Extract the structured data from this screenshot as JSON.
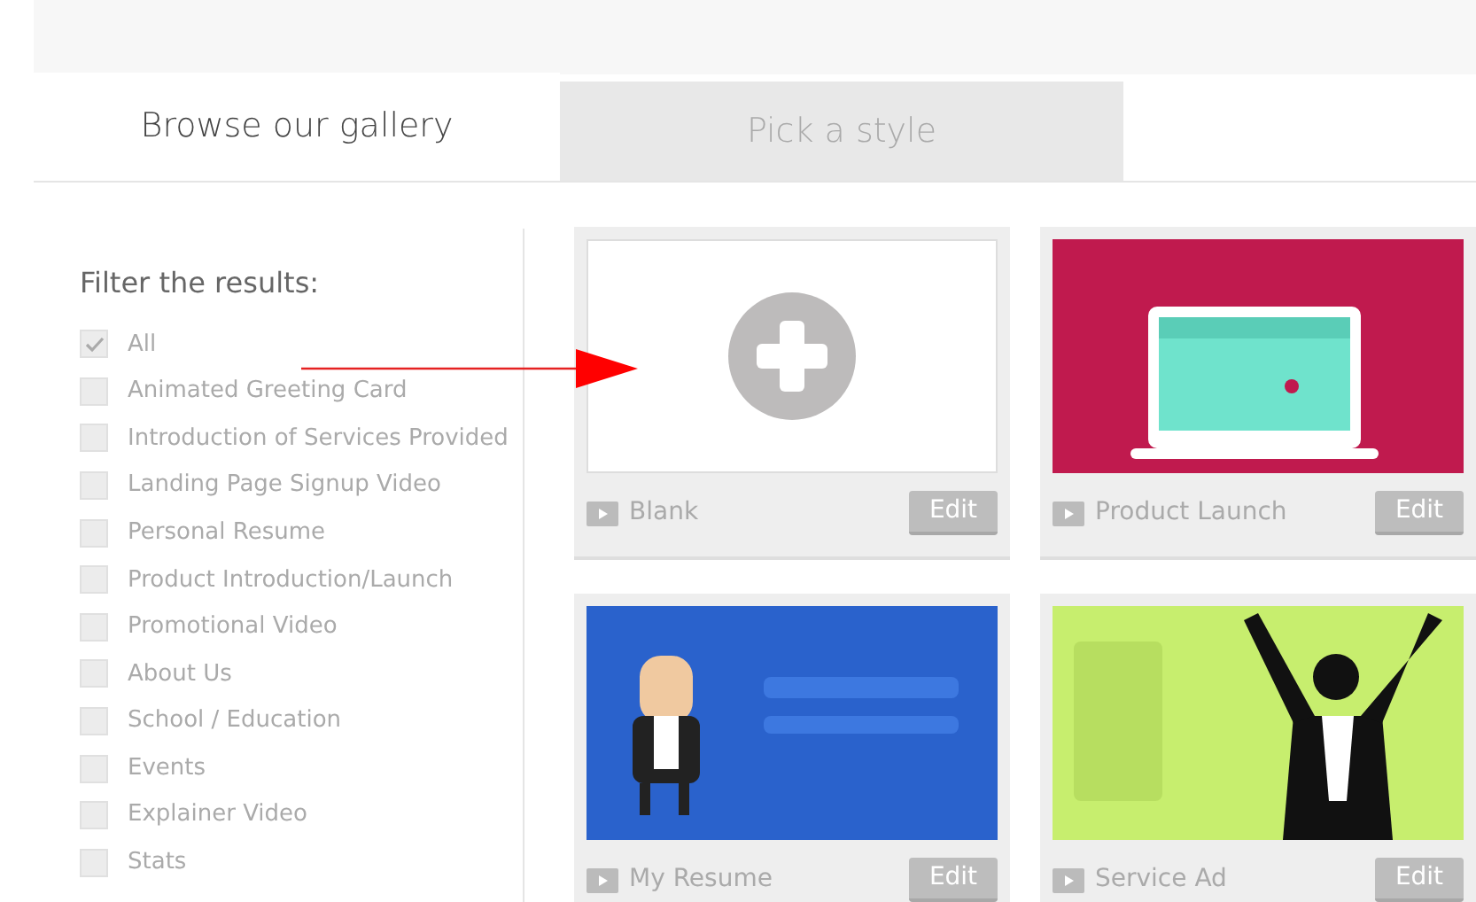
{
  "tabs": [
    {
      "label": "Browse our gallery",
      "selected": true
    },
    {
      "label": "Pick a style",
      "selected": false
    }
  ],
  "filter": {
    "title": "Filter the results:",
    "items": [
      {
        "label": "All",
        "checked": true
      },
      {
        "label": "Animated Greeting Card",
        "checked": false
      },
      {
        "label": "Introduction of Services Provided",
        "checked": false
      },
      {
        "label": "Landing Page Signup Video",
        "checked": false
      },
      {
        "label": "Personal Resume",
        "checked": false
      },
      {
        "label": "Product Introduction/Launch",
        "checked": false
      },
      {
        "label": "Promotional Video",
        "checked": false
      },
      {
        "label": "About Us",
        "checked": false
      },
      {
        "label": "School / Education",
        "checked": false
      },
      {
        "label": "Events",
        "checked": false
      },
      {
        "label": "Explainer Video",
        "checked": false
      },
      {
        "label": "Stats",
        "checked": false
      }
    ]
  },
  "cards": [
    {
      "kind": "blank",
      "title": "Blank",
      "button": "Edit"
    },
    {
      "kind": "laptop",
      "title": "Product Launch",
      "button": "Edit"
    },
    {
      "kind": "character",
      "title": "My Resume",
      "button": "Edit"
    },
    {
      "kind": "cheer",
      "title": "Service Ad",
      "button": "Edit"
    }
  ]
}
